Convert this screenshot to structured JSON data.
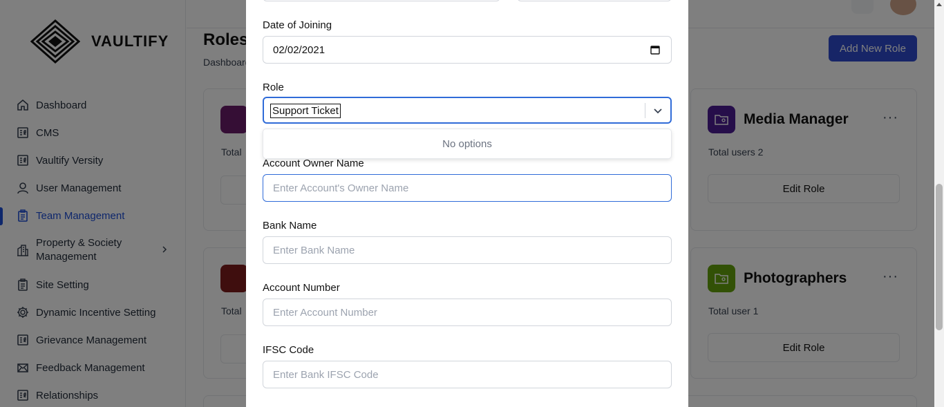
{
  "brand": {
    "name": "VAULTIFY"
  },
  "sidebar": {
    "items": [
      {
        "label": "Dashboard",
        "icon": "home-icon"
      },
      {
        "label": "CMS",
        "icon": "badge-icon"
      },
      {
        "label": "Vaultify Versity",
        "icon": "badge-icon"
      },
      {
        "label": "User Management",
        "icon": "user-icon"
      },
      {
        "label": "Team Management",
        "icon": "clipboard-icon",
        "active": true
      },
      {
        "label": "Property & Society Management",
        "icon": "building-icon",
        "has_children": true
      },
      {
        "label": "Site Setting",
        "icon": "clipboard-icon"
      },
      {
        "label": "Dynamic Incentive Setting",
        "icon": "gear-icon"
      },
      {
        "label": "Grievance Management",
        "icon": "badge-icon"
      },
      {
        "label": "Feedback Management",
        "icon": "mail-icon"
      },
      {
        "label": "Relationships",
        "icon": "badge-icon"
      }
    ]
  },
  "page": {
    "title": "Roles",
    "breadcrumb": "Dashboard",
    "add_button": "Add New Role"
  },
  "cards": [
    {
      "name": "Media Manager",
      "users": "Total users 2",
      "edit": "Edit Role",
      "color": "#4c1d95"
    },
    {
      "name": "Photographers",
      "users": "Total user 1",
      "edit": "Edit Role",
      "color": "#65a30d"
    },
    {
      "users": "Total",
      "color": "#6b1d6b"
    },
    {
      "users": "Total",
      "color": "#7f1d1d"
    }
  ],
  "modal": {
    "date_of_joining": {
      "label": "Date of Joining",
      "value": "02/02/2021"
    },
    "role": {
      "label": "Role",
      "value": "Support Ticket",
      "menu_text": "No options"
    },
    "account_owner": {
      "label": "Account Owner Name",
      "placeholder": "Enter Account's Owner Name"
    },
    "bank_name": {
      "label": "Bank Name",
      "placeholder": "Enter Bank Name"
    },
    "account_number": {
      "label": "Account Number",
      "placeholder": "Enter Account Number"
    },
    "ifsc": {
      "label": "IFSC Code",
      "placeholder": "Enter Bank IFSC Code"
    }
  },
  "colors": {
    "accent": "#2f4bcf",
    "focus": "#2f6bd8",
    "overlay": "rgba(0,0,0,0.5)"
  }
}
